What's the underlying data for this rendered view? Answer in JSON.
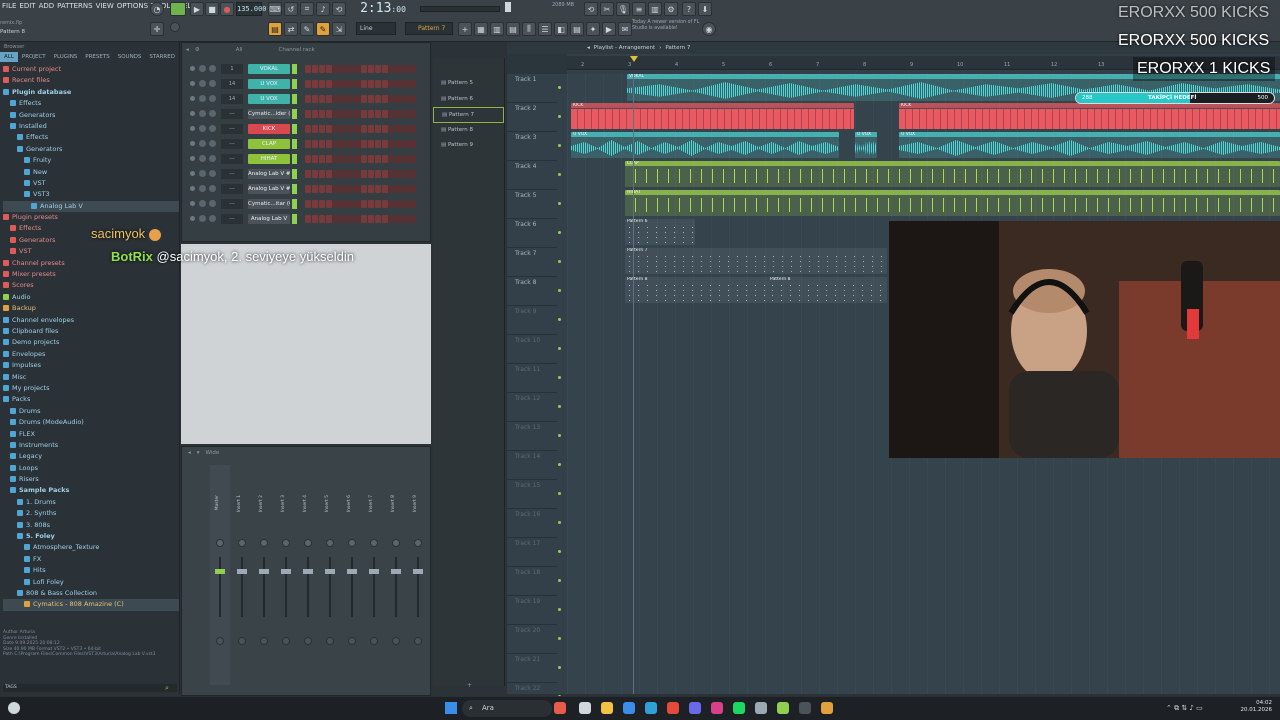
{
  "menu": [
    "FILE",
    "EDIT",
    "ADD",
    "PATTERNS",
    "VIEW",
    "OPTIONS",
    "TOOLS",
    "HELP"
  ],
  "toolbar": {
    "tempo": "135.000",
    "time": "2:13",
    "time_small": "00",
    "pattern_selector": "Pattern 7",
    "snap": "Line",
    "news": "Today  A newer version of FL Studio is available!",
    "cpu_mem": "2089 MB",
    "song_name": "remix.flp",
    "hint": "Pattern 8"
  },
  "browser": {
    "tabs": [
      "ALL",
      "PROJECT",
      "PLUGINS",
      "PRESETS",
      "SOUNDS",
      "STARRED"
    ],
    "header": "Browser",
    "items": [
      {
        "label": "Current project",
        "color": "#e05a5a",
        "indent": 0
      },
      {
        "label": "Recent files",
        "color": "#e05a5a",
        "indent": 0
      },
      {
        "label": "Plugin database",
        "color": "#4fa5d4",
        "indent": 0,
        "bold": true
      },
      {
        "label": "Effects",
        "color": "#4fa5d4",
        "indent": 1
      },
      {
        "label": "Generators",
        "color": "#4fa5d4",
        "indent": 1
      },
      {
        "label": "Installed",
        "color": "#4fa5d4",
        "indent": 1
      },
      {
        "label": "Effects",
        "color": "#4fa5d4",
        "indent": 2
      },
      {
        "label": "Generators",
        "color": "#4fa5d4",
        "indent": 2
      },
      {
        "label": "Fruity",
        "color": "#4fa5d4",
        "indent": 3
      },
      {
        "label": "New",
        "color": "#4fa5d4",
        "indent": 3
      },
      {
        "label": "VST",
        "color": "#4fa5d4",
        "indent": 3
      },
      {
        "label": "VST3",
        "color": "#4fa5d4",
        "indent": 3
      },
      {
        "label": "Analog Lab V",
        "color": "#4fa5d4",
        "indent": 4,
        "selected": true
      },
      {
        "label": "Plugin presets",
        "color": "#e05a5a",
        "indent": 0
      },
      {
        "label": "Effects",
        "color": "#e05a5a",
        "indent": 1
      },
      {
        "label": "Generators",
        "color": "#e05a5a",
        "indent": 1
      },
      {
        "label": "VST",
        "color": "#e05a5a",
        "indent": 1
      },
      {
        "label": "Channel presets",
        "color": "#e05a5a",
        "indent": 0
      },
      {
        "label": "Mixer presets",
        "color": "#e05a5a",
        "indent": 0
      },
      {
        "label": "Scores",
        "color": "#e05a5a",
        "indent": 0
      },
      {
        "label": "Audio",
        "color": "#8fd14f",
        "indent": 0
      },
      {
        "label": "Backup",
        "color": "#e0a03a",
        "indent": 0
      },
      {
        "label": "Channel envelopes",
        "color": "#4fa5d4",
        "indent": 0
      },
      {
        "label": "Clipboard files",
        "color": "#4fa5d4",
        "indent": 0
      },
      {
        "label": "Demo projects",
        "color": "#4fa5d4",
        "indent": 0
      },
      {
        "label": "Envelopes",
        "color": "#4fa5d4",
        "indent": 0
      },
      {
        "label": "Impulses",
        "color": "#4fa5d4",
        "indent": 0
      },
      {
        "label": "Misc",
        "color": "#4fa5d4",
        "indent": 0
      },
      {
        "label": "My projects",
        "color": "#4fa5d4",
        "indent": 0
      },
      {
        "label": "Packs",
        "color": "#4fa5d4",
        "indent": 0
      },
      {
        "label": "Drums",
        "color": "#4fa5d4",
        "indent": 1
      },
      {
        "label": "Drums (ModeAudio)",
        "color": "#4fa5d4",
        "indent": 1
      },
      {
        "label": "FLEX",
        "color": "#4fa5d4",
        "indent": 1
      },
      {
        "label": "Instruments",
        "color": "#4fa5d4",
        "indent": 1
      },
      {
        "label": "Legacy",
        "color": "#4fa5d4",
        "indent": 1
      },
      {
        "label": "Loops",
        "color": "#4fa5d4",
        "indent": 1
      },
      {
        "label": "Risers",
        "color": "#4fa5d4",
        "indent": 1
      },
      {
        "label": "Sample Packs",
        "color": "#4fa5d4",
        "indent": 1,
        "bold": true
      },
      {
        "label": "1. Drums",
        "color": "#4fa5d4",
        "indent": 2
      },
      {
        "label": "2. Synths",
        "color": "#4fa5d4",
        "indent": 2
      },
      {
        "label": "3. 808s",
        "color": "#4fa5d4",
        "indent": 2
      },
      {
        "label": "5. Foley",
        "color": "#4fa5d4",
        "indent": 2,
        "bold": true
      },
      {
        "label": "Atmosphere_Texture",
        "color": "#4fa5d4",
        "indent": 3
      },
      {
        "label": "FX",
        "color": "#4fa5d4",
        "indent": 3
      },
      {
        "label": "Hits",
        "color": "#4fa5d4",
        "indent": 3
      },
      {
        "label": "Lofi Foley",
        "color": "#4fa5d4",
        "indent": 3
      },
      {
        "label": "808 & Bass Collection",
        "color": "#4fa5d4",
        "indent": 2
      },
      {
        "label": "Cymatics - 808 Amazine (C)",
        "color": "#e0a03a",
        "indent": 3,
        "selected": true
      }
    ],
    "info": [
      "Author  Arturia",
      "Genre   Installed",
      "Date    9.09.2025 20:08:12",
      "Size    40.90 MB  Format VST2 • VST3 • 64-bit",
      "Path    C:\\Program Files\\Common Files\\VST3\\Arturia\\Analog Lab V.vst3"
    ],
    "tags_label": "TAGS"
  },
  "channel_rack": {
    "title": "Channel rack",
    "filter": "All",
    "channels": [
      {
        "num": "1",
        "name": "VOKAL",
        "color": "#3fb3a8"
      },
      {
        "num": "14",
        "name": "U VOX",
        "color": "#3fb3a8"
      },
      {
        "num": "14",
        "name": "U VOX",
        "color": "#3fb3a8"
      },
      {
        "num": "---",
        "name": "Cymatic...ider (C)",
        "color": "#4a5358"
      },
      {
        "num": "---",
        "name": "KICK",
        "color": "#d9474f"
      },
      {
        "num": "---",
        "name": "CLAP",
        "color": "#8fc23b"
      },
      {
        "num": "---",
        "name": "HIHAT",
        "color": "#8fc23b"
      },
      {
        "num": "---",
        "name": "Analog Lab V #2",
        "color": "#4a5358"
      },
      {
        "num": "---",
        "name": "Analog Lab V #3",
        "color": "#4a5358"
      },
      {
        "num": "---",
        "name": "Cymatic...itar (C)",
        "color": "#4a5358"
      },
      {
        "num": "---",
        "name": "Analog Lab V",
        "color": "#4a5358"
      }
    ]
  },
  "mixer": {
    "title": "Wide",
    "master": "Master",
    "inserts": [
      "Insert 1",
      "Insert 2",
      "Insert 3",
      "Insert 4",
      "Insert 5",
      "Insert 6",
      "Insert 7",
      "Insert 8",
      "Insert 9"
    ]
  },
  "patterns": [
    "Pattern 5",
    "Pattern 6",
    "Pattern 7",
    "Pattern 8",
    "Pattern 9"
  ],
  "selected_pattern": 2,
  "playlist": {
    "title": "Playlist - Arrangement",
    "pattern": "Pattern 7",
    "ruler": [
      "2",
      "3",
      "4",
      "5",
      "6",
      "7",
      "8",
      "9",
      "10",
      "11",
      "12",
      "13",
      "14",
      "15"
    ],
    "tracks": [
      "Track 1",
      "Track 2",
      "Track 3",
      "Track 4",
      "Track 5",
      "Track 6",
      "Track 7",
      "Track 8",
      "Track 9",
      "Track 10",
      "Track 11",
      "Track 12",
      "Track 13",
      "Track 14",
      "Track 15",
      "Track 16",
      "Track 17",
      "Track 18",
      "Track 19",
      "Track 20",
      "Track 21",
      "Track 22"
    ],
    "clip_labels": {
      "vokal": "VOKAL",
      "kick": "KICK",
      "uvox": "U VOX",
      "clap": "CLAP",
      "hihat": "HIHAT",
      "p6": "Pattern 6",
      "p7": "Pattern 7",
      "p8": "Pattern 8"
    }
  },
  "overlay": {
    "goal_1": "ERORXX  500 KICKS",
    "goal_2": "ERORXX  500 KICKS",
    "goal_3": "ERORXX  1 KICKS",
    "follower_label": "TAKİPÇİ HEDEFİ",
    "follower_current": "288",
    "follower_target": "500",
    "follower_progress": 0.576,
    "chat_user": "sacimyok",
    "bot_name": "BotRix",
    "bot_message": "@sacimyok, 2. seviyeye yükseldin"
  },
  "taskbar": {
    "search_placeholder": "Ara",
    "time": "04:02",
    "date": "20.01.2026"
  },
  "colors": {
    "vokal": "#4fd6d6",
    "kick": "#e85a62",
    "uvox": "#4fd6d6",
    "clap": "#a7dd4b",
    "hihat": "#a7dd4b",
    "pattern": "#9aa9b3",
    "accent": "#8fd14f"
  }
}
